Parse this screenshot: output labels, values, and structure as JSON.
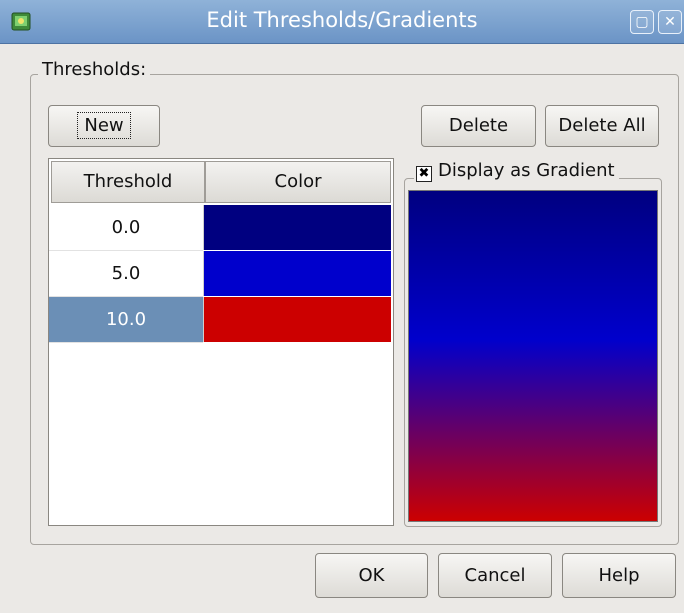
{
  "window": {
    "title": "Edit Thresholds/Gradients",
    "icons": [
      "app-icon",
      "maximize-icon",
      "close-icon"
    ]
  },
  "thresholds_group": {
    "legend": "Thresholds:",
    "new_label": "New",
    "delete_label": "Delete",
    "delete_all_label": "Delete All"
  },
  "table": {
    "columns": [
      "Threshold",
      "Color"
    ],
    "rows": [
      {
        "threshold": "0.0",
        "color": "#000080",
        "selected": false
      },
      {
        "threshold": "5.0",
        "color": "#0000cc",
        "selected": false
      },
      {
        "threshold": "10.0",
        "color": "#cc0000",
        "selected": true
      }
    ],
    "selection_color": "#6b8fb6"
  },
  "gradient": {
    "label": "Display as Gradient",
    "checked": true,
    "stops": [
      "#000080",
      "#0000cc",
      "#cc0000"
    ]
  },
  "footer": {
    "ok_label": "OK",
    "cancel_label": "Cancel",
    "help_label": "Help"
  }
}
